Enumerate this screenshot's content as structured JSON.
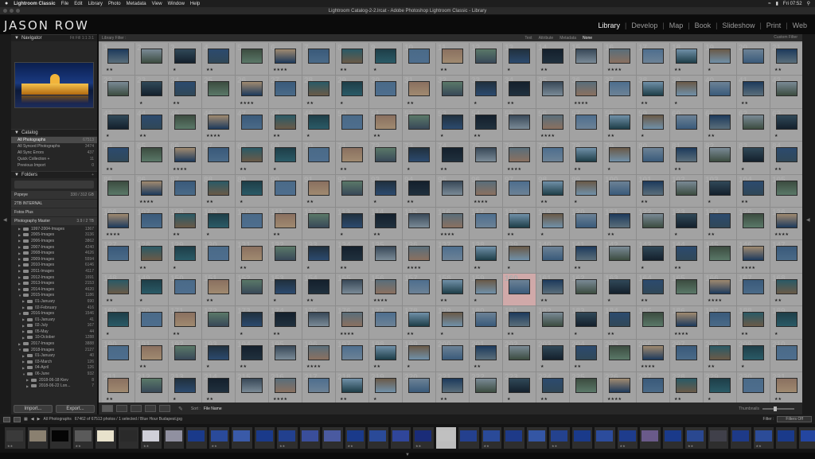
{
  "menubar": {
    "apple": "",
    "app": "Lightroom Classic",
    "items": [
      "File",
      "Edit",
      "Library",
      "Photo",
      "Metadata",
      "View",
      "Window",
      "Help"
    ],
    "clock": "Fri 07:52"
  },
  "window": {
    "title": "Lightroom Catalog-2-2.lrcat - Adobe Photoshop Lightroom Classic - Library"
  },
  "identity_plate": "JASON ROW",
  "modules": [
    {
      "label": "Library",
      "active": true
    },
    {
      "label": "Develop",
      "active": false
    },
    {
      "label": "Map",
      "active": false
    },
    {
      "label": "Book",
      "active": false
    },
    {
      "label": "Slideshow",
      "active": false
    },
    {
      "label": "Print",
      "active": false
    },
    {
      "label": "Web",
      "active": false
    }
  ],
  "navigator": {
    "title": "Navigator",
    "zoom": "Fit  Fill  1:1  3:1"
  },
  "catalog": {
    "title": "Catalog",
    "items": [
      {
        "label": "All Photographs",
        "count": "67513",
        "selected": true
      },
      {
        "label": "All Synced Photographs",
        "count": "3474",
        "selected": false
      },
      {
        "label": "All Sync Errors",
        "count": "437",
        "selected": false
      },
      {
        "label": "Quick Collection +",
        "count": "11",
        "selected": false
      },
      {
        "label": "Previous Import",
        "count": "0",
        "selected": false
      }
    ]
  },
  "folders": {
    "title": "Folders",
    "volumes": [
      {
        "label": "Popeye",
        "count": "330 / 312 GB"
      },
      {
        "label": "2TB INTERNAL",
        "count": ""
      },
      {
        "label": "Fotos Plus",
        "count": ""
      },
      {
        "label": "Photography Master",
        "count": "3.9 / 2 TB"
      }
    ],
    "tree": [
      {
        "label": "1997-2004-Images",
        "count": "1367",
        "indent": 1,
        "open": false
      },
      {
        "label": "2005-Images",
        "count": "3136",
        "indent": 1,
        "open": false
      },
      {
        "label": "2006-Images",
        "count": "3862",
        "indent": 1,
        "open": false
      },
      {
        "label": "2007-Images",
        "count": "4240",
        "indent": 1,
        "open": false
      },
      {
        "label": "2008-Images",
        "count": "4626",
        "indent": 1,
        "open": false
      },
      {
        "label": "2009-Images",
        "count": "5594",
        "indent": 1,
        "open": false
      },
      {
        "label": "2010-Images",
        "count": "6146",
        "indent": 1,
        "open": false
      },
      {
        "label": "2011-Images",
        "count": "4117",
        "indent": 1,
        "open": false
      },
      {
        "label": "2012-Images",
        "count": "1691",
        "indent": 1,
        "open": false
      },
      {
        "label": "2013-Images",
        "count": "2153",
        "indent": 1,
        "open": false
      },
      {
        "label": "2014-Images",
        "count": "4620",
        "indent": 1,
        "open": false
      },
      {
        "label": "2015-Images",
        "count": "1186",
        "indent": 1,
        "open": true
      },
      {
        "label": "01-January",
        "count": "690",
        "indent": 2,
        "open": false
      },
      {
        "label": "02-February",
        "count": "416",
        "indent": 2,
        "open": false
      },
      {
        "label": "2016-Images",
        "count": "1546",
        "indent": 1,
        "open": true
      },
      {
        "label": "01-January",
        "count": "41",
        "indent": 2,
        "open": false
      },
      {
        "label": "02-July",
        "count": "167",
        "indent": 2,
        "open": false
      },
      {
        "label": "05-May",
        "count": "44",
        "indent": 2,
        "open": false
      },
      {
        "label": "10-October",
        "count": "1288",
        "indent": 2,
        "open": false
      },
      {
        "label": "2017-Images",
        "count": "3888",
        "indent": 1,
        "open": false
      },
      {
        "label": "2018-Images",
        "count": "2127",
        "indent": 1,
        "open": true
      },
      {
        "label": "01-January",
        "count": "40",
        "indent": 2,
        "open": false
      },
      {
        "label": "03-March",
        "count": "126",
        "indent": 2,
        "open": false
      },
      {
        "label": "04-April",
        "count": "126",
        "indent": 2,
        "open": false
      },
      {
        "label": "06-June",
        "count": "932",
        "indent": 2,
        "open": true
      },
      {
        "label": "2018-06-18 Kiev",
        "count": "8",
        "indent": 3,
        "open": false
      },
      {
        "label": "2018-06-22 Lon...",
        "count": "7",
        "indent": 3,
        "open": false
      }
    ]
  },
  "buttons": {
    "import": "Import...",
    "export": "Export..."
  },
  "filter_bar": {
    "title": "Library Filter :",
    "options": [
      "Text",
      "Attribute",
      "Metadata",
      "None"
    ],
    "active": "None",
    "preset": "Custom Filter"
  },
  "grid": {
    "columns": 21,
    "rows": 11,
    "start_index": 1,
    "selected_index": 160,
    "thumb_colors": [
      "#1d3a5c",
      "#2c4a6e",
      "#3a5a7a",
      "#4a6a88",
      "#20303e",
      "#5a6e7a",
      "#6a5a48",
      "#7a8a96",
      "#3c4c40",
      "#2a5a66",
      "#8a7060",
      "#14202c",
      "#4e6e8e",
      "#6c8296",
      "#304858",
      "#a08a70",
      "#1e3e48",
      "#5a7868",
      "#384858",
      "#7090a8"
    ],
    "star_pattern": [
      "★★",
      "",
      "★",
      "★★",
      "",
      "★★★★",
      "",
      "★★",
      "★",
      ""
    ]
  },
  "toolbar": {
    "sort_label": "Sort :",
    "sort_value": "File Name",
    "thumbnails_label": "Thumbnails"
  },
  "filmstrip_bar": {
    "source": "All Photographs",
    "status": "67462 of 67513 photos / 1 selected / Blue Hour Budapest.jpg",
    "filter_label": "Filter :",
    "filter_value": "Filters Off"
  },
  "filmstrip": {
    "count": 36,
    "colors": [
      "#3a3a3a",
      "#8a8070",
      "#050505",
      "#5a5a5a",
      "#e8e2cc",
      "#2a2a2a",
      "#cfcfd8",
      "#9090a0",
      "#1a3a8a",
      "#2a4a9a",
      "#3a5aa8",
      "#1a3a8a",
      "#22408e",
      "#3a4e9a",
      "#4a5aa0",
      "#1a3a8a",
      "#2a4a98",
      "#30469a",
      "#1a2c78",
      "#c0c0c0",
      "#24408e",
      "#2a4a98",
      "#1e3a88",
      "#3456a4",
      "#24428e",
      "#1a3a8a",
      "#2c4c9c",
      "#1e3c8c",
      "#6a5a8a",
      "#1a3a8a",
      "#2a4890",
      "#40404a",
      "#1e3a88",
      "#2c4c98",
      "#1a3a8a",
      "#2446a0"
    ],
    "highlight_index": 19
  }
}
